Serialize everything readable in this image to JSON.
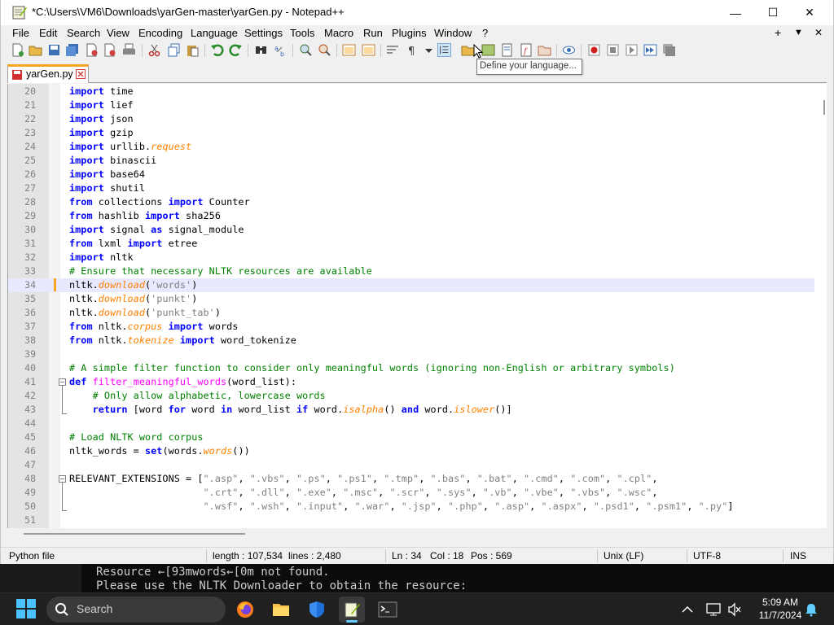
{
  "window": {
    "title": "*C:\\Users\\VM6\\Downloads\\yarGen-master\\yarGen.py - Notepad++",
    "minimize": "—",
    "maximize": "☐",
    "close": "✕"
  },
  "menu": {
    "items": [
      "File",
      "Edit",
      "Search",
      "View",
      "Encoding",
      "Language",
      "Settings",
      "Tools",
      "Macro",
      "Run",
      "Plugins",
      "Window",
      "?"
    ],
    "right": [
      "+",
      "▼",
      "✕"
    ]
  },
  "tooltip": "Define your language...",
  "tab": {
    "label": "yarGen.py"
  },
  "editor": {
    "current_line": 34,
    "lines": [
      {
        "n": "20",
        "html": "<span class=\"kw\">import</span> time"
      },
      {
        "n": "21",
        "html": "<span class=\"kw\">import</span> lief"
      },
      {
        "n": "22",
        "html": "<span class=\"kw\">import</span> json"
      },
      {
        "n": "23",
        "html": "<span class=\"kw\">import</span> gzip"
      },
      {
        "n": "24",
        "html": "<span class=\"kw\">import</span> urllib.<span class=\"fn\">request</span>"
      },
      {
        "n": "25",
        "html": "<span class=\"kw\">import</span> binascii"
      },
      {
        "n": "26",
        "html": "<span class=\"kw\">import</span> base64"
      },
      {
        "n": "27",
        "html": "<span class=\"kw\">import</span> shutil"
      },
      {
        "n": "28",
        "html": "<span class=\"kw\">from</span> collections <span class=\"kw\">import</span> Counter"
      },
      {
        "n": "29",
        "html": "<span class=\"kw\">from</span> hashlib <span class=\"kw\">import</span> sha256"
      },
      {
        "n": "30",
        "html": "<span class=\"kw\">import</span> signal <span class=\"kw\">as</span> signal_module"
      },
      {
        "n": "31",
        "html": "<span class=\"kw\">from</span> lxml <span class=\"kw\">import</span> etree"
      },
      {
        "n": "32",
        "html": "<span class=\"kw\">import</span> nltk"
      },
      {
        "n": "33",
        "html": "<span class=\"cm\"># Ensure that necessary NLTK resources are available</span>"
      },
      {
        "n": "34",
        "html": "nltk.<span class=\"fn\">download</span>(<span class=\"st\">'words'</span>)"
      },
      {
        "n": "35",
        "html": "nltk.<span class=\"fn\">download</span>(<span class=\"st\">'punkt'</span>)"
      },
      {
        "n": "36",
        "html": "nltk.<span class=\"fn\">download</span>(<span class=\"st\">'punkt_tab'</span>)"
      },
      {
        "n": "37",
        "html": "<span class=\"kw\">from</span> nltk.<span class=\"fn\">corpus</span> <span class=\"kw\">import</span> words"
      },
      {
        "n": "38",
        "html": "<span class=\"kw\">from</span> nltk.<span class=\"fn\">tokenize</span> <span class=\"kw\">import</span> word_tokenize"
      },
      {
        "n": "39",
        "html": ""
      },
      {
        "n": "40",
        "html": "<span class=\"cm\"># A simple filter function to consider only meaningful words (ignoring non-English or arbitrary symbols)</span>"
      },
      {
        "n": "41",
        "html": "<span class=\"kw\">def</span> <span class=\"df\">filter_meaningful_words</span>(word_list):"
      },
      {
        "n": "42",
        "html": "    <span class=\"cm\"># Only allow alphabetic, lowercase words</span>"
      },
      {
        "n": "43",
        "html": "    <span class=\"kw\">return</span> [word <span class=\"kw\">for</span> word <span class=\"kw\">in</span> word_list <span class=\"kw\">if</span> word.<span class=\"fn\">isalpha</span>() <span class=\"kw\">and</span> word.<span class=\"fn\">islower</span>()]"
      },
      {
        "n": "44",
        "html": ""
      },
      {
        "n": "45",
        "html": "<span class=\"cm\"># Load NLTK word corpus</span>"
      },
      {
        "n": "46",
        "html": "nltk_words = <span class=\"kw\">set</span>(words.<span class=\"fn\">words</span>())"
      },
      {
        "n": "47",
        "html": ""
      },
      {
        "n": "48",
        "html": "RELEVANT_EXTENSIONS = [<span class=\"st\">\".asp\"</span>, <span class=\"st\">\".vbs\"</span>, <span class=\"st\">\".ps\"</span>, <span class=\"st\">\".ps1\"</span>, <span class=\"st\">\".tmp\"</span>, <span class=\"st\">\".bas\"</span>, <span class=\"st\">\".bat\"</span>, <span class=\"st\">\".cmd\"</span>, <span class=\"st\">\".com\"</span>, <span class=\"st\">\".cpl\"</span>,"
      },
      {
        "n": "49",
        "html": "                       <span class=\"st\">\".crt\"</span>, <span class=\"st\">\".dll\"</span>, <span class=\"st\">\".exe\"</span>, <span class=\"st\">\".msc\"</span>, <span class=\"st\">\".scr\"</span>, <span class=\"st\">\".sys\"</span>, <span class=\"st\">\".vb\"</span>, <span class=\"st\">\".vbe\"</span>, <span class=\"st\">\".vbs\"</span>, <span class=\"st\">\".wsc\"</span>,"
      },
      {
        "n": "50",
        "html": "                       <span class=\"st\">\".wsf\"</span>, <span class=\"st\">\".wsh\"</span>, <span class=\"st\">\".input\"</span>, <span class=\"st\">\".war\"</span>, <span class=\"st\">\".jsp\"</span>, <span class=\"st\">\".php\"</span>, <span class=\"st\">\".asp\"</span>, <span class=\"st\">\".aspx\"</span>, <span class=\"st\">\".psd1\"</span>, <span class=\"st\">\".psm1\"</span>, <span class=\"st\">\".py\"</span>]"
      },
      {
        "n": "51",
        "html": ""
      }
    ]
  },
  "status": {
    "file_type": "Python file",
    "length": "length : 107,534",
    "lines": "lines : 2,480",
    "ln": "Ln : 34",
    "col": "Col : 18",
    "pos": "Pos : 569",
    "eol": "Unix (LF)",
    "encoding": "UTF-8",
    "mode": "INS"
  },
  "terminal": {
    "line1": "Resource ←[93mwords←[0m not found.",
    "line2": "Please use the NLTK Downloader to obtain the resource:"
  },
  "taskbar": {
    "search_label": "Search",
    "time": "5:09 AM",
    "date": "11/7/2024"
  },
  "colors": {
    "keyword": "#0000ff",
    "comment": "#008000",
    "string": "#808080",
    "function_italic": "#ff8000",
    "def_name": "#ff00ff",
    "current_line_bg": "#e8e8ff",
    "tab_accent": "#f5a623",
    "taskbar_accent": "#60cdff"
  }
}
